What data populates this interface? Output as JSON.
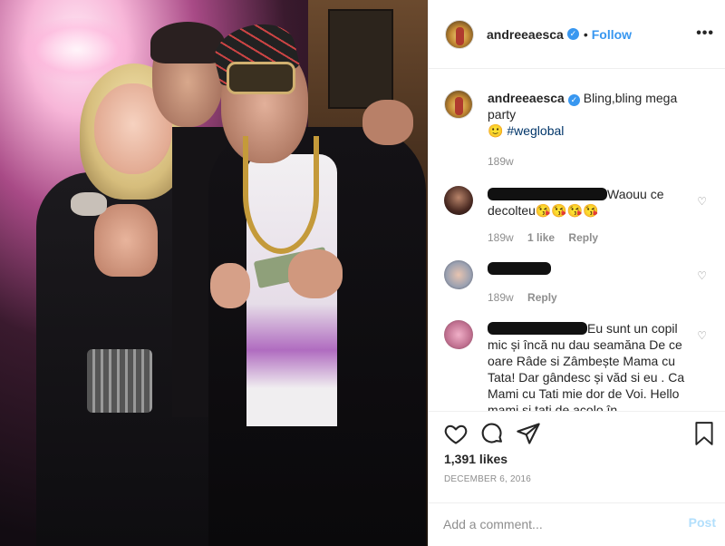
{
  "post": {
    "username": "andreeaesca",
    "follow_label": "Follow",
    "dot": "•",
    "more": "•••",
    "caption": {
      "username": "andreeaesca",
      "text": "Bling,bling mega party",
      "emoji": "🙂",
      "hashtag": "#weglobal",
      "time": "189w"
    },
    "comments": [
      {
        "text": "Waouu ce decolteu😘😘😘😘",
        "time": "189w",
        "likes": "1 like",
        "reply": "Reply"
      },
      {
        "text": "",
        "time": "189w",
        "reply": "Reply"
      },
      {
        "text": "Eu sunt un copil mic și încă nu dau seamăna De ce oare Râde si Zâmbește Mama cu Tata! Dar gândesc și văd si eu . Ca Mami cu Tati mie dor de Voi. Hello mami si tati de acolo în"
      }
    ],
    "likes": "1,391 likes",
    "date": "DECEMBER 6, 2016",
    "add_comment_placeholder": "Add a comment...",
    "post_label": "Post",
    "colors": {
      "accent": "#3897f0",
      "post_disabled": "#b2dffc",
      "muted": "#8e8e8e",
      "text": "#262626"
    },
    "icons": {
      "heart": "heart-icon",
      "comment": "comment-icon",
      "share": "share-icon",
      "bookmark": "bookmark-icon",
      "verified": "verified-badge-icon"
    }
  }
}
